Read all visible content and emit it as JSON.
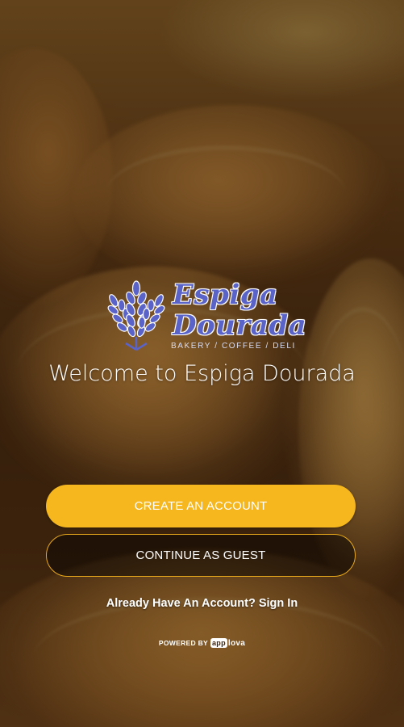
{
  "brand": {
    "line1": "Espiga",
    "line2": "Dourada",
    "tagline": "BAKERY / COFFEE / DELI",
    "color": "#5a63c8"
  },
  "welcome_text": "Welcome to Espiga Dourada",
  "buttons": {
    "create_account": "CREATE AN ACCOUNT",
    "continue_guest": "CONTINUE AS GUEST"
  },
  "signin_text": "Already Have An Account? Sign In",
  "footer": {
    "powered_by": "POWERED BY",
    "logo_box": "app",
    "logo_rest": "lova"
  },
  "colors": {
    "accent": "#f5b61e",
    "text": "#ffffff"
  },
  "icons": {
    "logo": "wheat-icon"
  }
}
